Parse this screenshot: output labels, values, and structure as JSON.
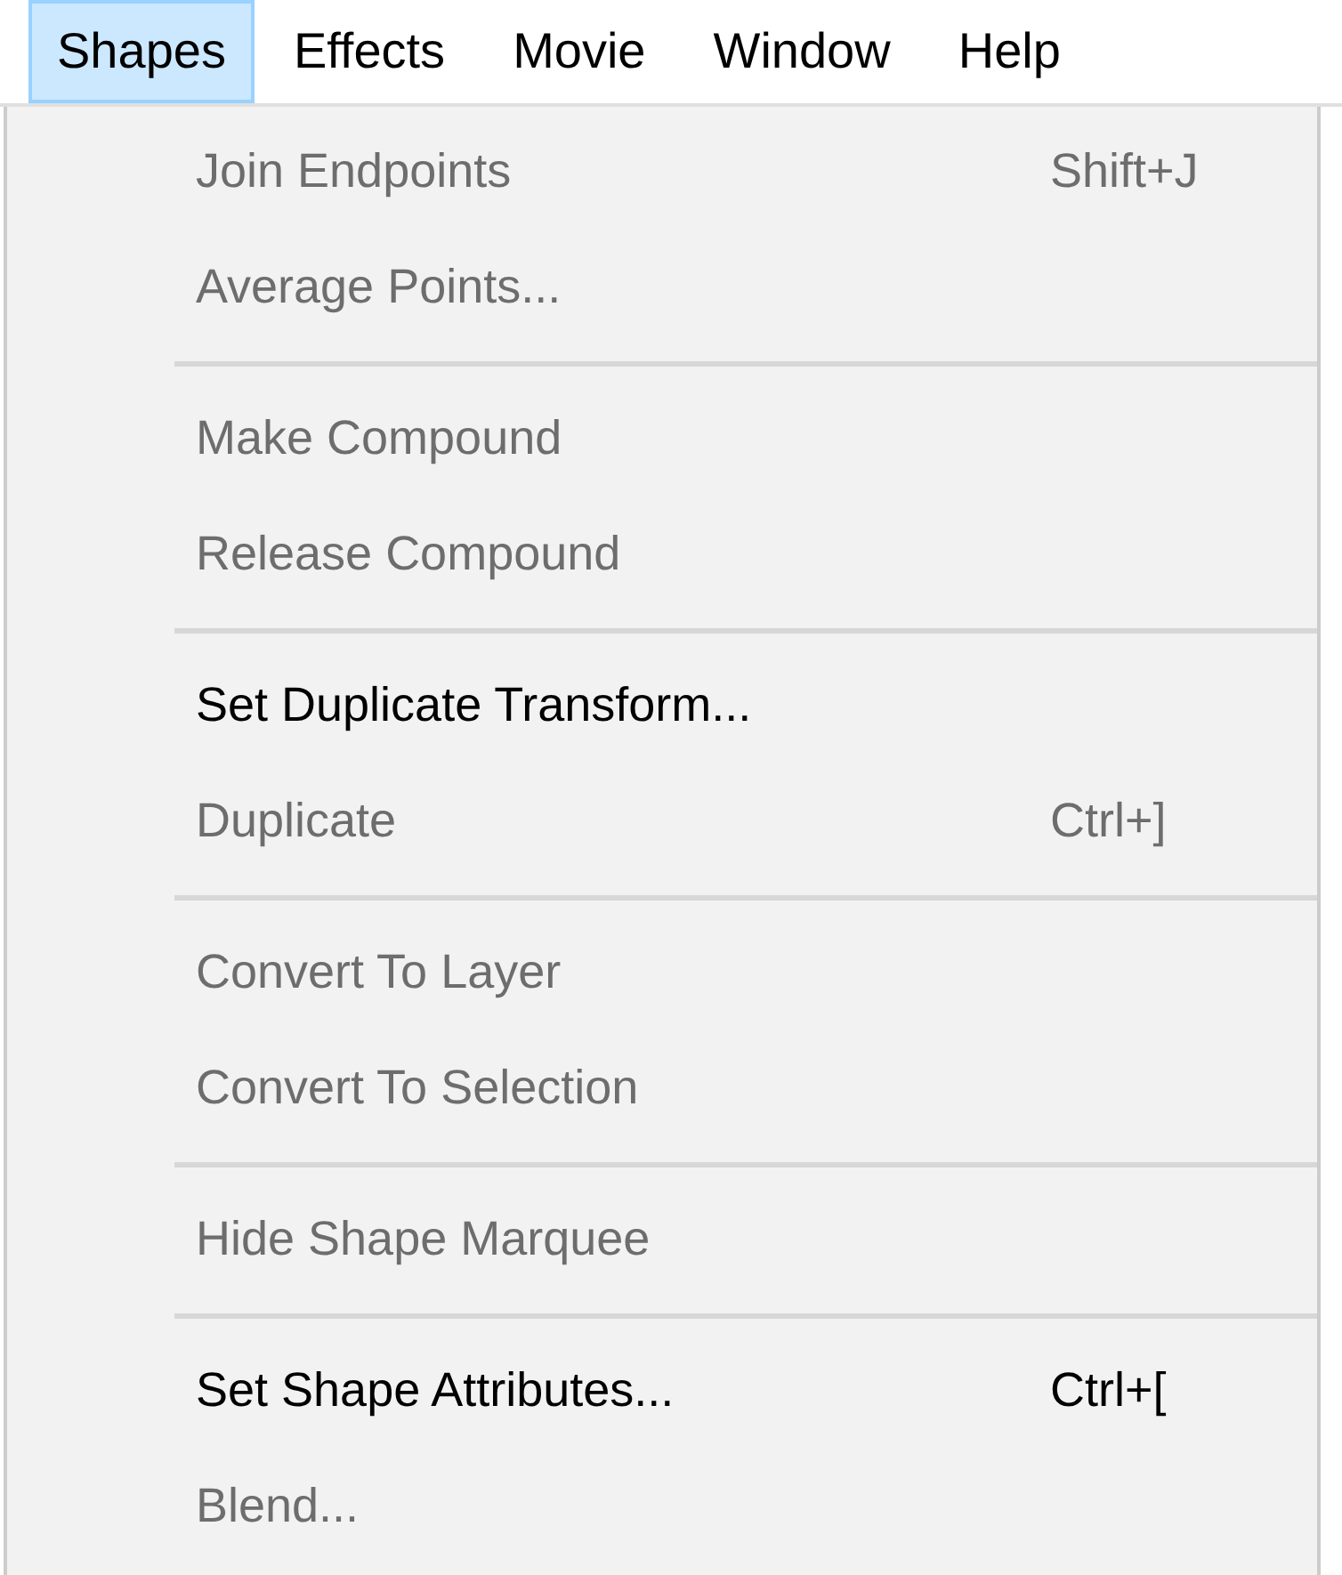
{
  "menubar": [
    {
      "label": "Shapes",
      "selected": true
    },
    {
      "label": "Effects",
      "selected": false
    },
    {
      "label": "Movie",
      "selected": false
    },
    {
      "label": "Window",
      "selected": false
    },
    {
      "label": "Help",
      "selected": false
    }
  ],
  "menu": [
    {
      "kind": "item",
      "label": "Join Endpoints",
      "shortcut": "Shift+J",
      "disabled": true
    },
    {
      "kind": "item",
      "label": "Average Points...",
      "disabled": true
    },
    {
      "kind": "separator"
    },
    {
      "kind": "item",
      "label": "Make Compound",
      "disabled": true
    },
    {
      "kind": "item",
      "label": "Release Compound",
      "disabled": true
    },
    {
      "kind": "separator"
    },
    {
      "kind": "item",
      "label": "Set Duplicate Transform...",
      "disabled": false
    },
    {
      "kind": "item",
      "label": "Duplicate",
      "shortcut": "Ctrl+]",
      "disabled": true
    },
    {
      "kind": "separator"
    },
    {
      "kind": "item",
      "label": "Convert To Layer",
      "disabled": true
    },
    {
      "kind": "item",
      "label": "Convert To Selection",
      "disabled": true
    },
    {
      "kind": "separator"
    },
    {
      "kind": "item",
      "label": "Hide Shape Marquee",
      "disabled": true
    },
    {
      "kind": "separator"
    },
    {
      "kind": "item",
      "label": "Set Shape Attributes...",
      "shortcut": "Ctrl+[",
      "disabled": false
    },
    {
      "kind": "item",
      "label": "Blend...",
      "disabled": true
    }
  ]
}
